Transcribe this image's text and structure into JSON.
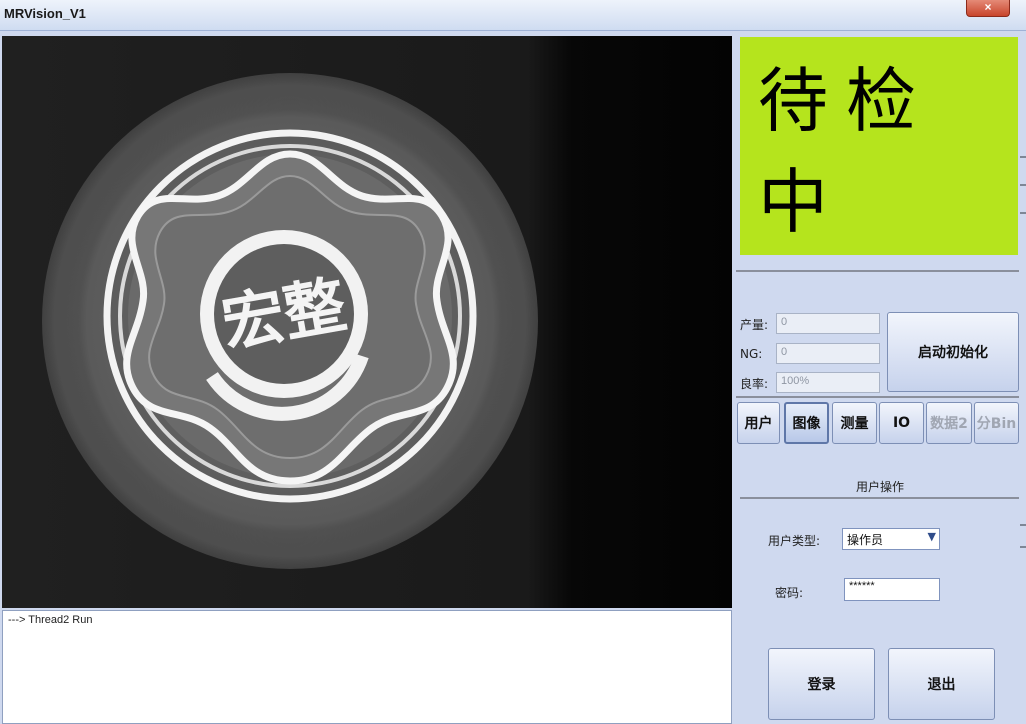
{
  "window": {
    "title": "MRVision_V1",
    "close_glyph": "×"
  },
  "status": {
    "text": "待检中",
    "color": "#b5e41d"
  },
  "stats": [
    {
      "label": "产量:",
      "value": "0"
    },
    {
      "label": "NG:",
      "value": "0"
    },
    {
      "label": "良率:",
      "value": "100%"
    }
  ],
  "init_button": "启动初始化",
  "tabs": [
    {
      "label": "用户",
      "state": "normal"
    },
    {
      "label": "图像",
      "state": "active"
    },
    {
      "label": "测量",
      "state": "normal"
    },
    {
      "label": "IO",
      "state": "normal"
    },
    {
      "label": "数据2",
      "state": "disabled"
    },
    {
      "label": "分Bin",
      "state": "disabled"
    }
  ],
  "user_panel": {
    "title": "用户操作",
    "type_label": "用户类型:",
    "type_value": "操作员",
    "password_label": "密码:",
    "password_value": "******",
    "login_button": "登录",
    "logout_button": "退出"
  },
  "log": {
    "lines": [
      "---> Thread2 Run"
    ]
  },
  "image": {
    "logo_text": "宏整"
  }
}
